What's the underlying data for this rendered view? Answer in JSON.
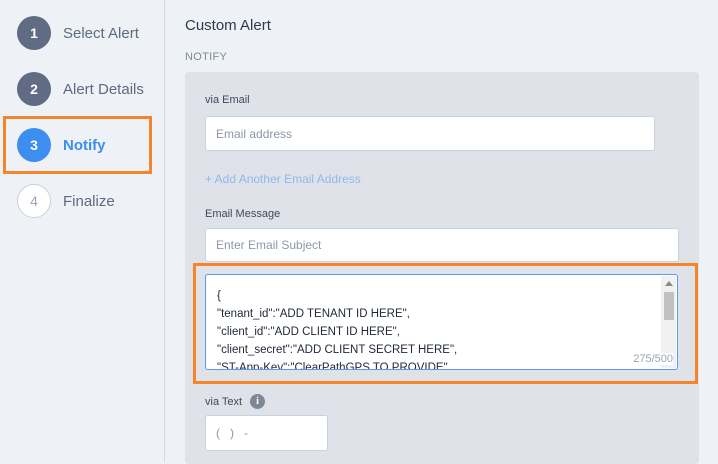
{
  "steps": [
    {
      "number": "1",
      "label": "Select Alert"
    },
    {
      "number": "2",
      "label": "Alert Details"
    },
    {
      "number": "3",
      "label": "Notify"
    },
    {
      "number": "4",
      "label": "Finalize"
    }
  ],
  "header": {
    "title": "Custom Alert",
    "section": "NOTIFY"
  },
  "email": {
    "label": "via Email",
    "placeholder": "Email address",
    "add_link": "+ Add Another Email Address"
  },
  "message": {
    "label": "Email Message",
    "subject_placeholder": "Enter Email Subject",
    "body_lines": [
      "{",
      "\"tenant_id\":\"ADD TENANT ID HERE\",",
      "\"client_id\":\"ADD CLIENT ID HERE\",",
      "\"client_secret\":\"ADD CLIENT SECRET HERE\",",
      "\"ST-App-Key\":\"ClearPathGPS TO PROVIDE\","
    ],
    "counter": "275/500"
  },
  "text": {
    "label": "via Text",
    "info_icon": "info-icon",
    "phone_placeholder": "(   )   -"
  },
  "colors": {
    "accent": "#3e8df0",
    "highlight": "#f5842a",
    "done_step": "#5f6c84"
  }
}
